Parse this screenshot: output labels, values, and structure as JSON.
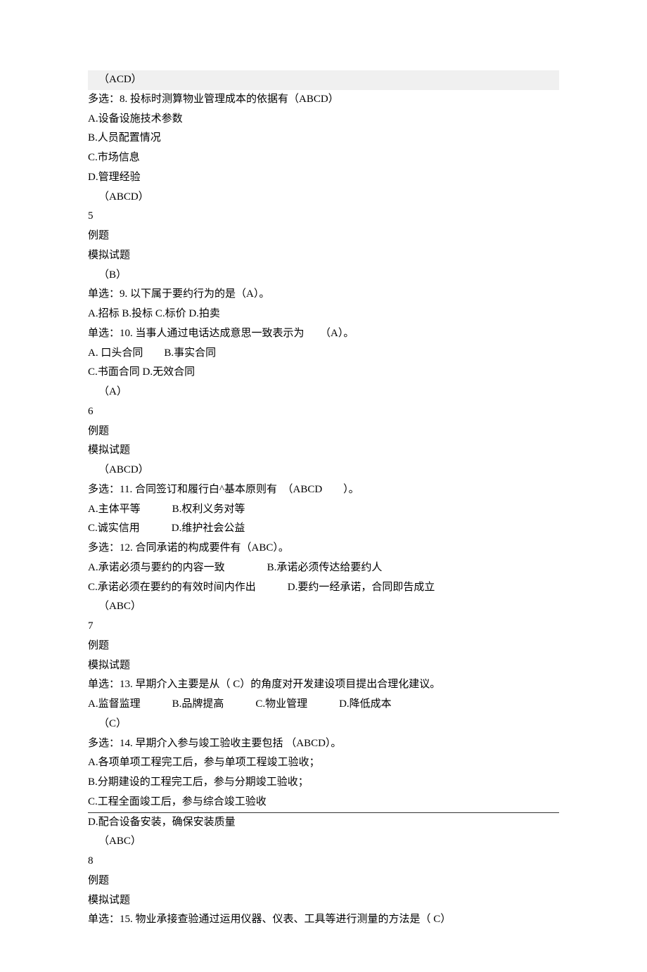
{
  "lines": [
    {
      "text": "（ACD）",
      "class": "highlighted indent"
    },
    {
      "text": "多选：8. 投标时测算物业管理成本的依据有（ABCD）"
    },
    {
      "text": "A.设备设施技术参数"
    },
    {
      "text": "B.人员配置情况"
    },
    {
      "text": "C.市场信息"
    },
    {
      "text": "D.管理经验"
    },
    {
      "text": "（ABCD）",
      "class": "indent"
    },
    {
      "text": "5"
    },
    {
      "text": "例题"
    },
    {
      "text": "模拟试题"
    },
    {
      "text": "（B）",
      "class": "indent"
    },
    {
      "text": "单选：9. 以下属于要约行为的是（A）。"
    },
    {
      "text": "A.招标  B.投标  C.标价  D.拍卖"
    },
    {
      "text": "单选：10. 当事人通过电话达成意思一致表示为　　（A）。"
    },
    {
      "text": "A.  口头合同　　B.事实合同"
    },
    {
      "text": "C.书面合同 D.无效合同"
    },
    {
      "text": "（A）",
      "class": "indent"
    },
    {
      "text": "6"
    },
    {
      "text": "例题"
    },
    {
      "text": "模拟试题"
    },
    {
      "text": "（ABCD）",
      "class": "indent"
    },
    {
      "text": "多选：11. 合同签订和履行白^基本原则有　（ABCD　　）。"
    },
    {
      "text": "A.主体平等　　　B.权利义务对等"
    },
    {
      "text": "C.诚实信用　　　D.维护社会公益"
    },
    {
      "text": "多选：12. 合同承诺的构成要件有（ABC）。"
    },
    {
      "text": "A.承诺必须与要约的内容一致　　　　B.承诺必须传达给要约人"
    },
    {
      "text": "C.承诺必须在要约的有效时间内作出　　　D.要约一经承诺，合同即告成立"
    },
    {
      "text": "（ABC）",
      "class": "indent"
    },
    {
      "text": "7"
    },
    {
      "text": "例题"
    },
    {
      "text": "模拟试题"
    },
    {
      "text": "单选：13. 早期介入主要是从（ C）的角度对开发建设项目提出合理化建议。"
    },
    {
      "text": "A.监督监理　　　B.品牌提高　　　C.物业管理　　　D.降低成本"
    },
    {
      "text": "（C）",
      "class": "indent"
    },
    {
      "text": "多选：14. 早期介入参与竣工验收主要包括 （ABCD）。"
    },
    {
      "text": "A.各项单项工程完工后，参与单项工程竣工验收；"
    },
    {
      "text": "B.分期建设的工程完工后，参与分期竣工验收；"
    },
    {
      "text": "C.工程全面竣工后，参与综合竣工验收"
    },
    {
      "text": "D.配合设备安装，确保安装质量",
      "class": "overlined fullwidth"
    },
    {
      "text": "（ABC）",
      "class": "indent"
    },
    {
      "text": "8"
    },
    {
      "text": "例题"
    },
    {
      "text": "模拟试题"
    },
    {
      "text": "单选：15. 物业承接查验通过运用仪器、仪表、工具等进行测量的方法是（ C）"
    }
  ]
}
